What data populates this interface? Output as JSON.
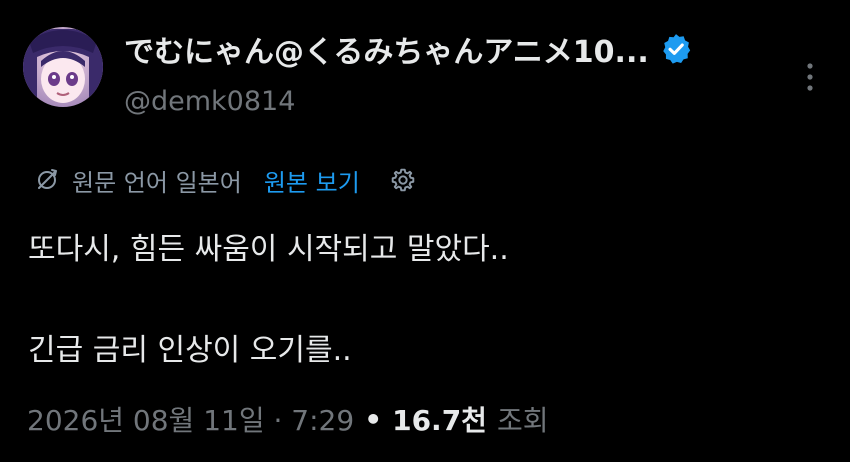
{
  "author": {
    "display_name": "でむにゃん@くるみちゃんアニメ10...",
    "handle": "@demk0814",
    "verified_color": "#1d9bf0"
  },
  "translation": {
    "source_label": "원문 언어 일본어",
    "show_original_label": "원본 보기",
    "icon": "translate-icon",
    "settings_icon": "gear-icon"
  },
  "tweet": {
    "lines": [
      "또다시, 힘든 싸움이 시작되고 말았다..",
      "긴급 금리 인상이 오기를.."
    ]
  },
  "meta": {
    "date": "2026년 08월 11일 · 7:29",
    "separator": "•",
    "views_count": "16.7천",
    "views_label": "조회"
  },
  "colors": {
    "background": "#000000",
    "text": "#e7e9ea",
    "muted": "#71767b",
    "link": "#1d9bf0"
  }
}
